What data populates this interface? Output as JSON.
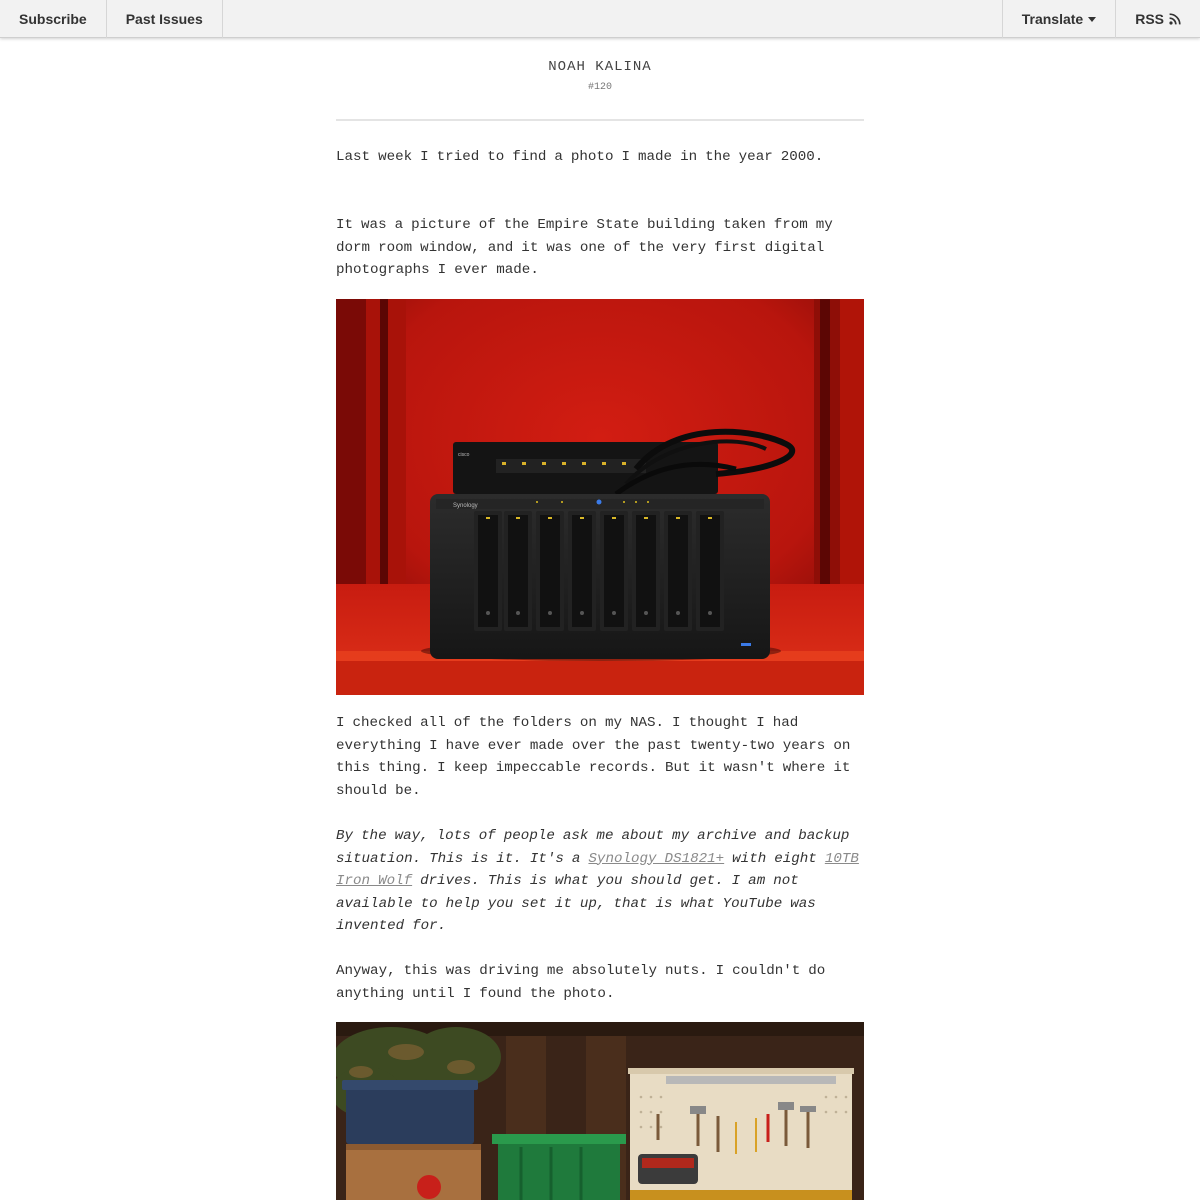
{
  "nav": {
    "subscribe": "Subscribe",
    "past_issues": "Past Issues",
    "translate": "Translate",
    "rss": "RSS"
  },
  "header": {
    "publication": "NOAH KALINA",
    "issue": "#120"
  },
  "body": {
    "p1": "Last week I tried to find a photo I made in the year 2000.",
    "p2": "It was a picture of the Empire State building taken from my dorm room window, and it was one of the very first digital photographs I ever made.",
    "p3": "I checked all of the folders on my NAS. I thought I had everything I have ever made over the past twenty-two years on this thing. I keep impeccable records. But it wasn't where it should be.",
    "p4_before_link1": "By the way, lots of people ask me about my archive and backup situation. This is it. It's a ",
    "link1": "Synology DS1821+",
    "p4_between": " with eight ",
    "link2": "10TB Iron Wolf",
    "p4_after": " drives. This is what you should get. I am not available to help you set it up, that is what YouTube was invented for.",
    "p5": "Anyway, this was driving me absolutely nuts. I couldn't do anything until I found the photo."
  },
  "photos": {
    "nas": {
      "brand_label": "Synology",
      "switch_label": "cisco",
      "bay_count": 8
    },
    "garage": {
      "content": "workbench with pegboard tools and storage bins"
    }
  },
  "colors": {
    "nav_bg": "#f2f2f2",
    "text": "#333333",
    "link": "#8a8a8a",
    "cabinet_red": "#c41a10"
  }
}
